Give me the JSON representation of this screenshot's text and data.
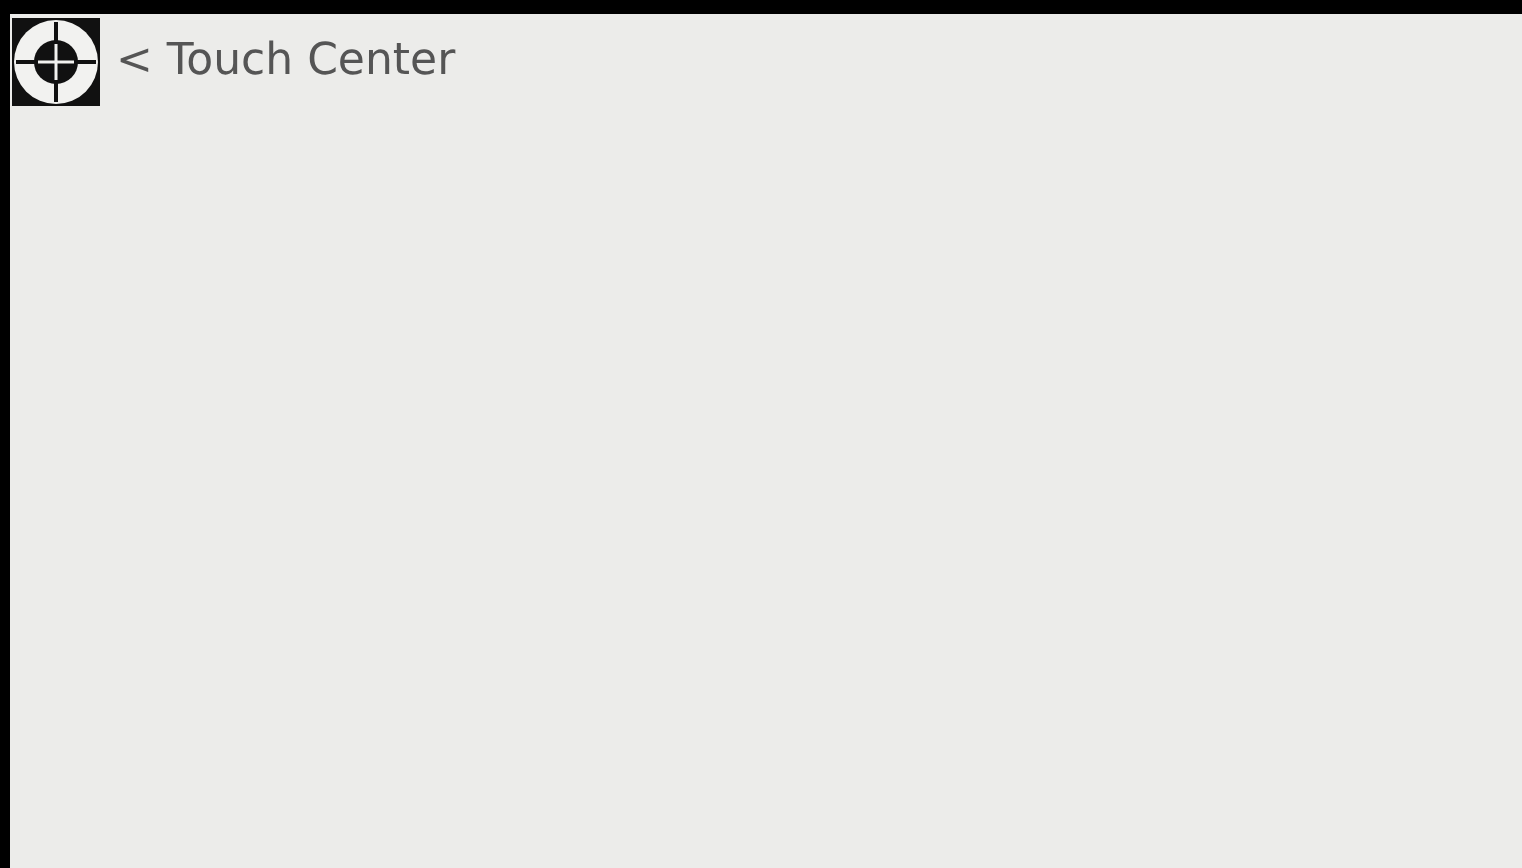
{
  "header": {
    "back_label": "< Touch Center"
  }
}
